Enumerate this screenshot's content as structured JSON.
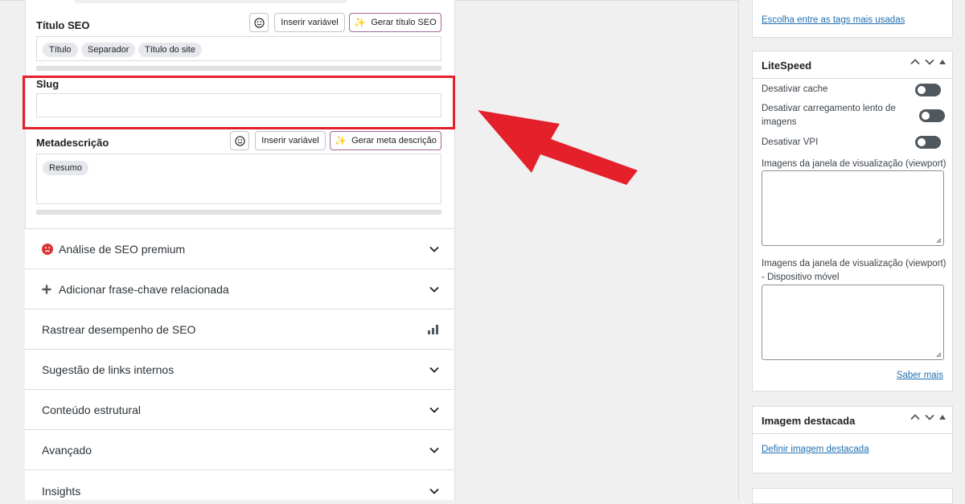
{
  "seo_title": {
    "label": "Título SEO",
    "insert_variable": "Inserir variável",
    "generate_ai": "Gerar título SEO",
    "tags": [
      "Título",
      "Separador",
      "Título do site"
    ]
  },
  "slug": {
    "label": "Slug",
    "value": ""
  },
  "meta_description": {
    "label": "Metadescrição",
    "insert_variable": "Inserir variável",
    "generate_ai": "Gerar meta descrição",
    "tags": [
      "Resumo"
    ]
  },
  "sections": [
    {
      "label": "Análise de SEO premium",
      "icon": "sad-face-icon"
    },
    {
      "label": "Adicionar frase-chave relacionada",
      "icon": "plus-icon"
    },
    {
      "label": "Rastrear desempenho de SEO",
      "icon": "bar-chart-icon"
    },
    {
      "label": "Sugestão de links internos",
      "icon": "chevron-down-icon"
    },
    {
      "label": "Conteúdo estrutural",
      "icon": "chevron-down-icon"
    },
    {
      "label": "Avançado",
      "icon": "chevron-down-icon"
    },
    {
      "label": "Insights",
      "icon": "chevron-down-icon"
    }
  ],
  "sidebar": {
    "tags_link": "Escolha entre as tags mais usadas",
    "litespeed": {
      "title": "LiteSpeed",
      "disable_cache": "Desativar cache",
      "disable_lazy": "Desativar carregamento lento de imagens",
      "disable_vpi": "Desativar VPI",
      "viewport_images": "Imagens da janela de visualização (viewport)",
      "viewport_images_mobile": "Imagens da janela de visualização (viewport) - Dispositivo móvel",
      "learn_more": "Saber mais"
    },
    "featured_image": {
      "title": "Imagem destacada",
      "set_link": "Definir imagem destacada"
    }
  },
  "colors": {
    "accent": "#2271b1",
    "highlight": "#e4202b",
    "ai_purple": "#a4286a",
    "error_red": "#dc3232"
  }
}
